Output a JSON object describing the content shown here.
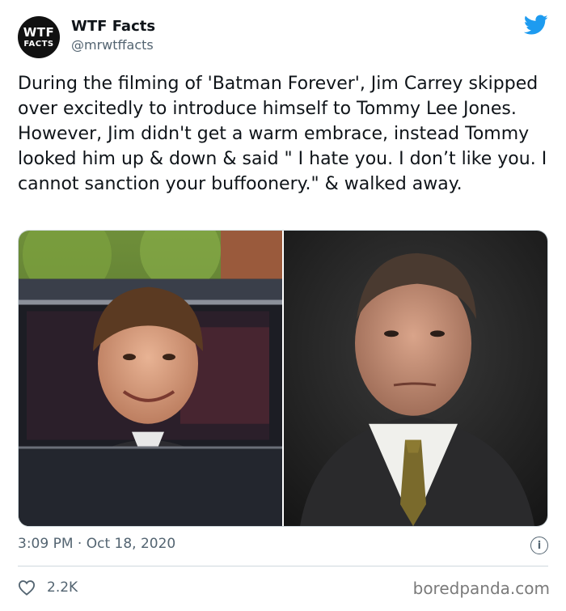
{
  "account": {
    "avatar_line1": "WTF",
    "avatar_line2": "FACTS",
    "name": "WTF Facts",
    "handle": "@mrwtffacts"
  },
  "tweet": {
    "text": "During the filming of 'Batman Forever', Jim Carrey skipped over excitedly to introduce himself to Tommy Lee Jones. However, Jim didn't get a warm embrace, instead Tommy looked him up & down & said \" I hate you. I don’t like you. I cannot sanction your buffoonery.\" & walked away.",
    "time": "3:09 PM",
    "separator": "·",
    "date": "Oct 18, 2020",
    "likes": "2.2K"
  },
  "watermark": "boredpanda.com",
  "icons": {
    "brand": "twitter-bird-icon",
    "info": "info-icon",
    "like": "heart-icon"
  },
  "colors": {
    "twitter_blue": "#1d9bf0",
    "secondary_text": "#536471"
  }
}
